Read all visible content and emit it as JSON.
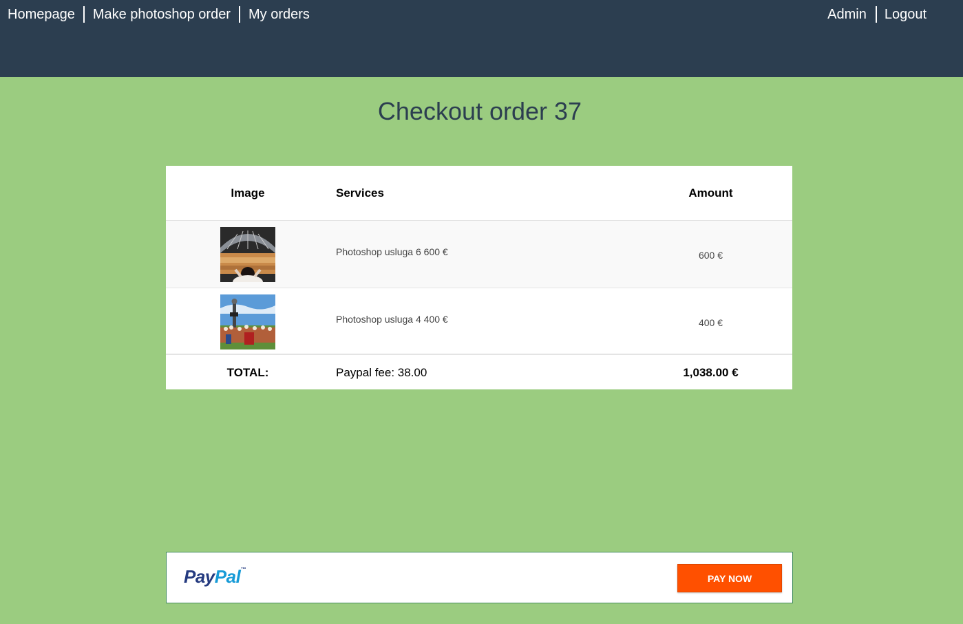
{
  "nav": {
    "left": [
      "Homepage",
      "Make photoshop order",
      "My orders"
    ],
    "right": [
      "Admin",
      "Logout"
    ]
  },
  "page_title": "Checkout order 37",
  "table": {
    "headers": {
      "image": "Image",
      "services": "Services",
      "amount": "Amount"
    },
    "rows": [
      {
        "service": "Photoshop usluga 6 600 €",
        "amount": "600 €",
        "thumb": "concert-crowd-photo"
      },
      {
        "service": "Photoshop usluga 4 400 €",
        "amount": "400 €",
        "thumb": "outdoor-group-photo"
      }
    ],
    "total": {
      "label": "TOTAL:",
      "fee": "Paypal fee: 38.00",
      "amount": "1,038.00 €"
    }
  },
  "paypal": {
    "logo_pay": "Pay",
    "logo_pal": "Pal",
    "tm": "™",
    "button": "PAY NOW"
  },
  "colors": {
    "topbar": "#2c3e50",
    "page_bg": "#9bcc80",
    "pay_button": "#ff5000"
  }
}
